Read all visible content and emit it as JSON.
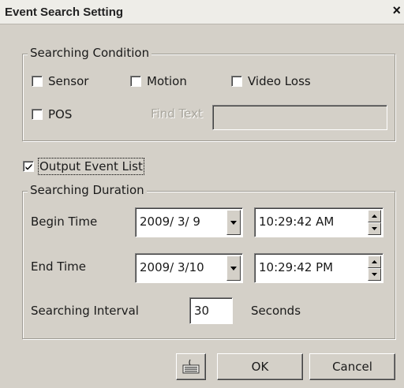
{
  "window": {
    "title": "Event Search Setting",
    "close_glyph": "×"
  },
  "searching_condition": {
    "legend": "Searching Condition",
    "sensor": {
      "label": "Sensor",
      "checked": false
    },
    "motion": {
      "label": "Motion",
      "checked": false
    },
    "video_loss": {
      "label": "Video Loss",
      "checked": false
    },
    "pos": {
      "label": "POS",
      "checked": false
    },
    "find_text": {
      "label": "Find Text",
      "value": ""
    }
  },
  "output_event_list": {
    "label": "Output Event List",
    "checked": true
  },
  "searching_duration": {
    "legend": "Searching Duration",
    "begin": {
      "label": "Begin Time",
      "date": "2009/ 3/ 9",
      "time": "10:29:42  AM"
    },
    "end": {
      "label": "End Time",
      "date": "2009/ 3/10",
      "time": "10:29:42  PM"
    },
    "interval": {
      "label": "Searching Interval",
      "value": "30",
      "unit": "Seconds"
    }
  },
  "buttons": {
    "keyboard_icon": "keyboard-icon",
    "ok": "OK",
    "cancel": "Cancel"
  }
}
